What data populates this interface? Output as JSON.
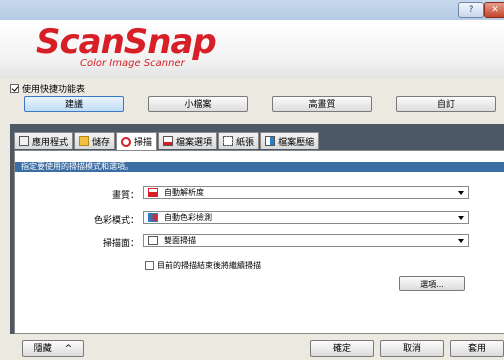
{
  "titlebar": {
    "help_label": "?",
    "close_label": "✕"
  },
  "logo": {
    "text": "ScanSnap",
    "subtitle": "Color Image Scanner"
  },
  "quick_menu": {
    "label": "使用快捷功能表",
    "checked": true
  },
  "presets": [
    "建議",
    "小檔案",
    "高畫質",
    "自訂"
  ],
  "tabs": [
    "應用程式",
    "儲存",
    "掃描",
    "檔案選項",
    "紙張",
    "檔案壓縮"
  ],
  "hint": "指定要使用的掃描模式和選項。",
  "fields": {
    "quality": {
      "label": "畫質：",
      "value": "自動解析度",
      "icon_color": "#d61f26"
    },
    "color_mode": {
      "label": "色彩模式：",
      "value": "自動色彩檢測",
      "icon_color": "#2a7fc9"
    },
    "scan_side": {
      "label": "掃描面：",
      "value": "雙面掃描",
      "icon_color": "#888888"
    }
  },
  "continue_scan": {
    "label": "目前的掃描結束後將繼續掃描",
    "checked": false
  },
  "options_label": "選項...",
  "bottom": {
    "hide_label": "隱藏",
    "hide_icon": "^",
    "ok_label": "確定",
    "cancel_label": "取消",
    "apply_label": "套用"
  }
}
